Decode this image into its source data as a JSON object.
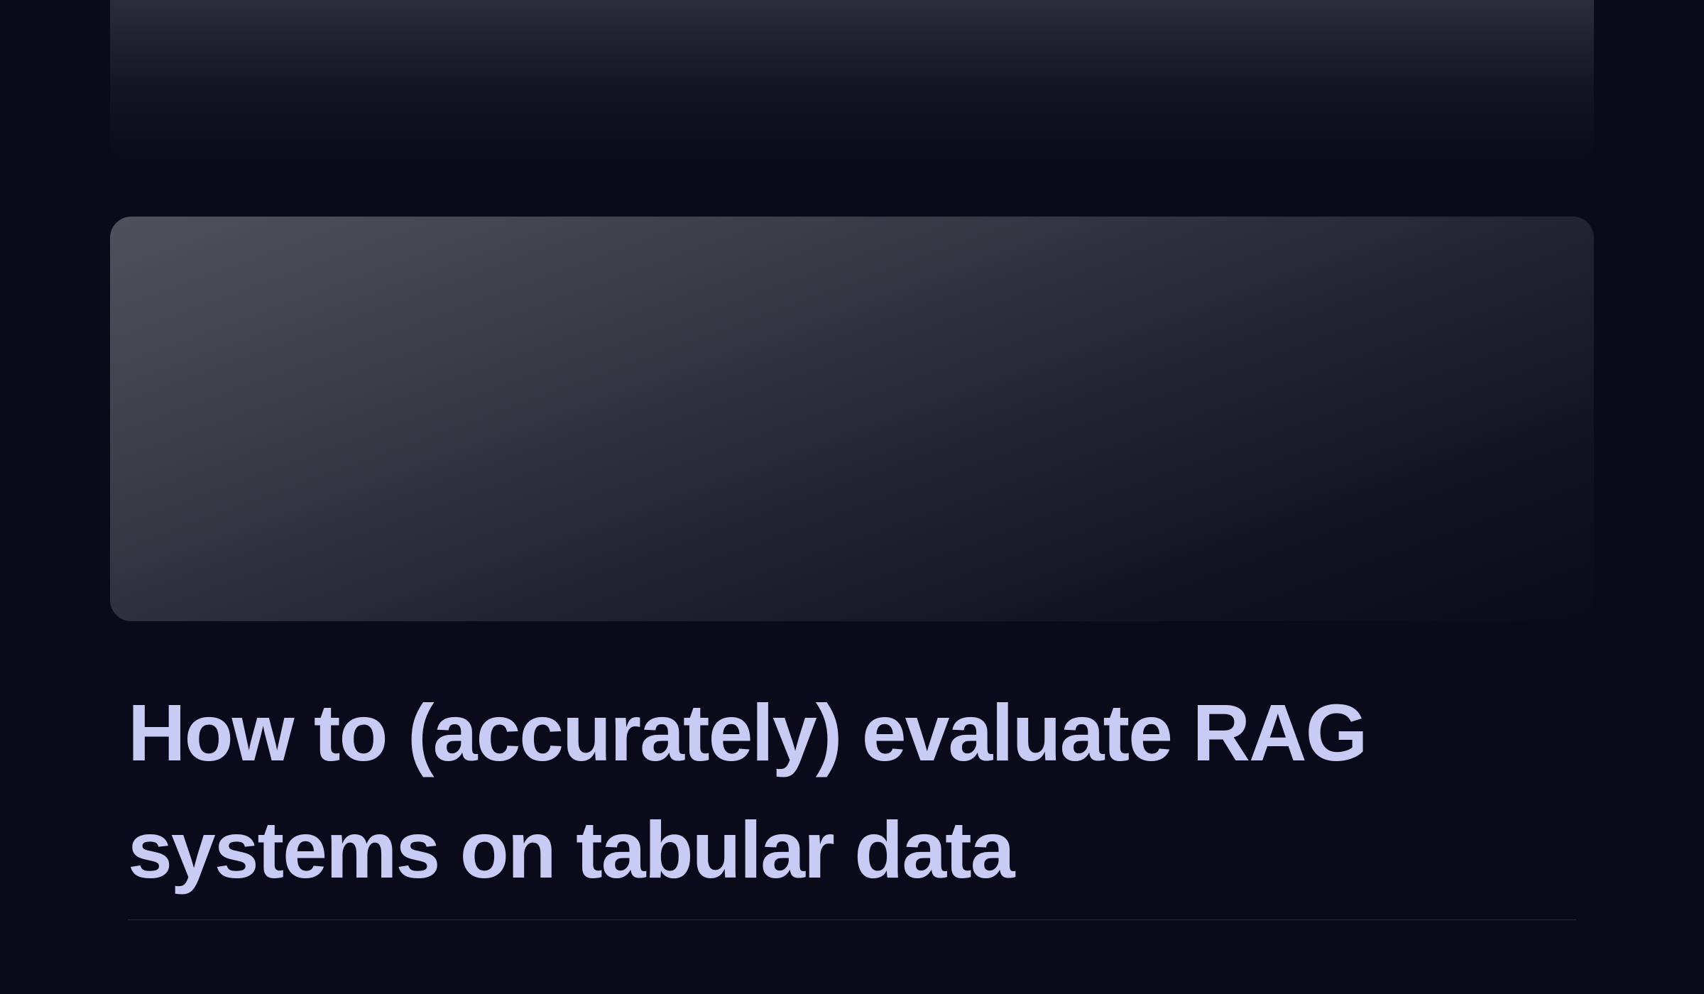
{
  "article": {
    "title": "How to (accurately) evaluate RAG systems on tabular data"
  },
  "colors": {
    "background": "#0a0a1a",
    "title_text": "#c8ccf5",
    "divider": "#2a2a3a"
  }
}
